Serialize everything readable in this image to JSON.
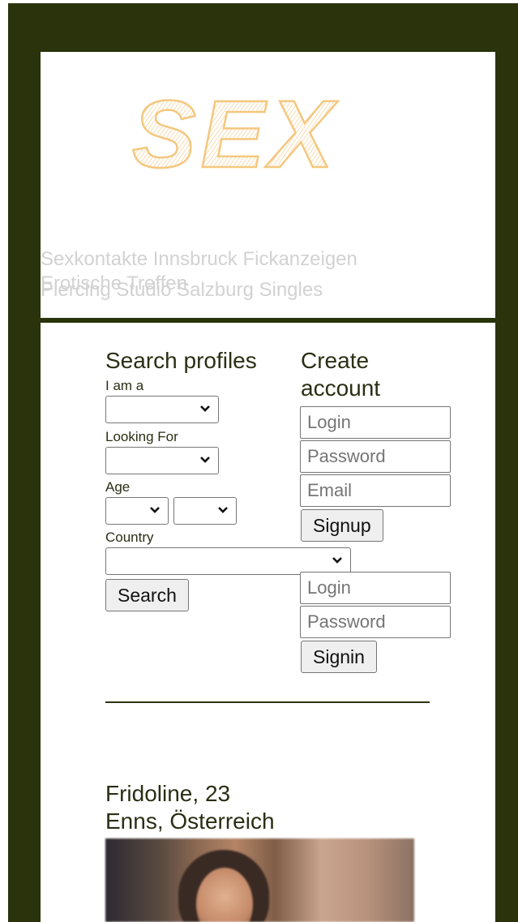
{
  "header": {
    "logo_text": "SEX",
    "links": [
      "Sexkontakte Innsbruck Fickanzeigen",
      "Erotische Treffen",
      "Piercing Studio Salzburg Singles"
    ]
  },
  "search": {
    "title": "Search profiles",
    "i_am_label": "I am a",
    "looking_for_label": "Looking For",
    "age_label": "Age",
    "country_label": "Country",
    "button": "Search"
  },
  "signup": {
    "title": "Create account",
    "login_placeholder": "Login",
    "password_placeholder": "Password",
    "email_placeholder": "Email",
    "button": "Signup"
  },
  "signin": {
    "login_placeholder": "Login",
    "password_placeholder": "Password",
    "button": "Signin"
  },
  "profile": {
    "name_age": "Fridoline, 23",
    "location": "Enns, Österreich"
  },
  "colors": {
    "frame": "#2a330b",
    "logo": "#f4c880",
    "muted_link": "#d2d2d2"
  }
}
